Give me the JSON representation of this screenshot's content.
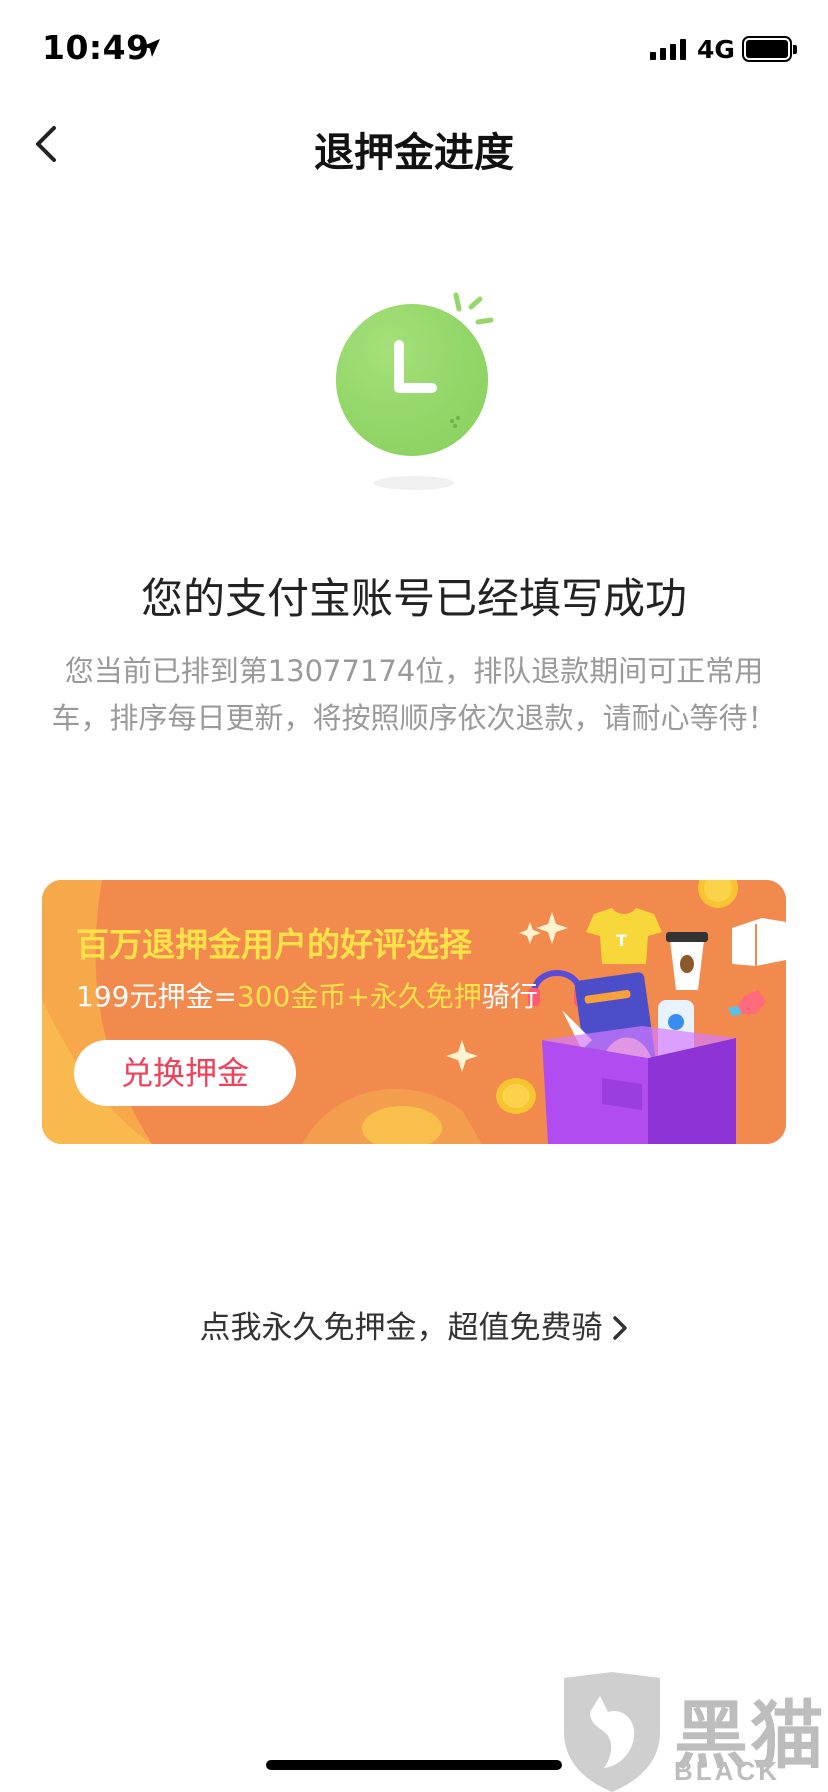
{
  "status_bar": {
    "time": "10:49",
    "network": "4G",
    "icons": [
      "location-arrow-icon",
      "signal-bars-icon",
      "battery-icon"
    ]
  },
  "nav": {
    "title": "退押金进度",
    "back_icon": "chevron-left-icon"
  },
  "illustration": {
    "icon": "clock-icon",
    "accent": "#95d86a"
  },
  "result": {
    "title": "您的支付宝账号已经填写成功",
    "description": "您当前已排到第13077174位，排队退款期间可正常用车，排序每日更新，将按照顺序依次退款，请耐心等待！"
  },
  "banner": {
    "title": "百万退押金用户的好评选择",
    "sub_part1": "199元押金=",
    "sub_part2": "300金币+永久免押",
    "sub_part3": "骑行",
    "button_label": "兑换押金",
    "colors": {
      "background": "#f2894d",
      "highlight": "#ffe14a",
      "button_text": "#f0405a"
    }
  },
  "footer_link": {
    "label": "点我永久免押金，超值免费骑",
    "icon": "chevron-right-icon"
  },
  "watermark": {
    "cn": "黑猫",
    "en": "BLACK CAT"
  }
}
